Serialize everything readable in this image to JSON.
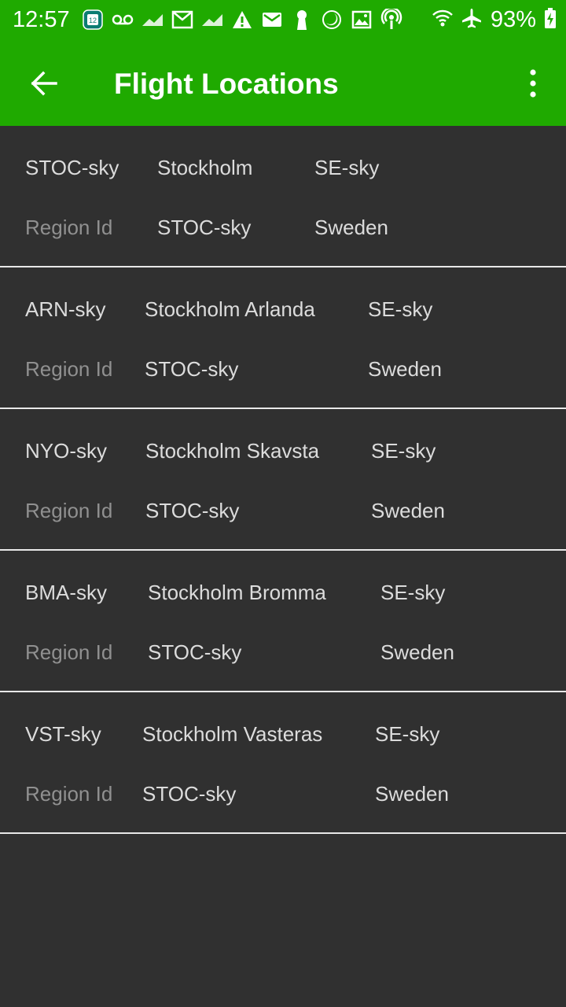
{
  "status_bar": {
    "time": "12:57",
    "calendar_badge": "12",
    "battery": "93%"
  },
  "toolbar": {
    "title": "Flight Locations"
  },
  "colors": {
    "app_bar": "#1faa00",
    "background": "#303030",
    "divider": "#e8e8e8"
  },
  "icons": [
    "calendar-icon",
    "voicemail-icon",
    "trending-icon",
    "gmail-icon",
    "trending-icon",
    "warning-icon",
    "mail-icon",
    "keyhole-icon",
    "moon-icon",
    "image-icon",
    "podcast-icon",
    "wifi-icon",
    "airplane-icon",
    "battery-charging-icon",
    "back-arrow-icon",
    "more-vert-icon"
  ],
  "locations": [
    {
      "code": "STOC-sky",
      "name": "Stockholm",
      "country_code": "SE-sky",
      "region_label": "Region Id",
      "region": "STOC-sky",
      "country": "Sweden"
    },
    {
      "code": "ARN-sky",
      "name": "Stockholm Arlanda",
      "country_code": "SE-sky",
      "region_label": "Region Id",
      "region": "STOC-sky",
      "country": "Sweden"
    },
    {
      "code": "NYO-sky",
      "name": "Stockholm Skavsta",
      "country_code": "SE-sky",
      "region_label": "Region Id",
      "region": "STOC-sky",
      "country": "Sweden"
    },
    {
      "code": "BMA-sky",
      "name": "Stockholm Bromma",
      "country_code": "SE-sky",
      "region_label": "Region Id",
      "region": "STOC-sky",
      "country": "Sweden"
    },
    {
      "code": "VST-sky",
      "name": "Stockholm Vasteras",
      "country_code": "SE-sky",
      "region_label": "Region Id",
      "region": "STOC-sky",
      "country": "Sweden"
    }
  ]
}
